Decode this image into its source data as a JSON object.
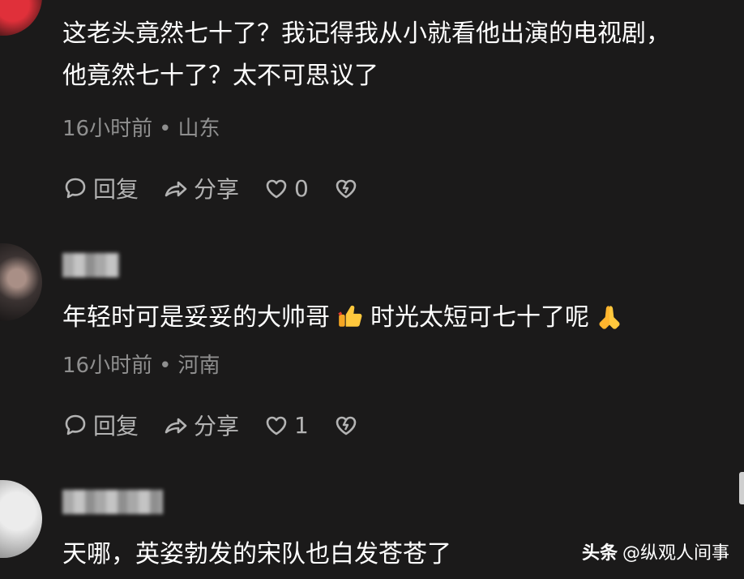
{
  "comments": [
    {
      "lines": [
        "这老头竟然七十了？我记得我从小就看他出演的电视剧，",
        "他竟然七十了？太不可思议了"
      ],
      "time": "16小时前",
      "location": "山东",
      "reply_label": "回复",
      "share_label": "分享",
      "like_count": "0"
    },
    {
      "text_part1": "年轻时可是妥妥的大帅哥",
      "text_part2": "时光太短可七十了呢",
      "time": "16小时前",
      "location": "河南",
      "reply_label": "回复",
      "share_label": "分享",
      "like_count": "1"
    },
    {
      "text": "天哪，英姿勃发的宋队也白发苍苍了"
    }
  ],
  "icons": {
    "reply": "comment-bubble-icon",
    "share": "share-arrow-icon",
    "like": "heart-outline-icon",
    "dislike": "broken-heart-icon",
    "emoji1": "thumbs-up-emoji",
    "emoji2": "folded-hands-emoji"
  },
  "watermark": {
    "brand": "头条",
    "account": "@纵观人间事"
  }
}
